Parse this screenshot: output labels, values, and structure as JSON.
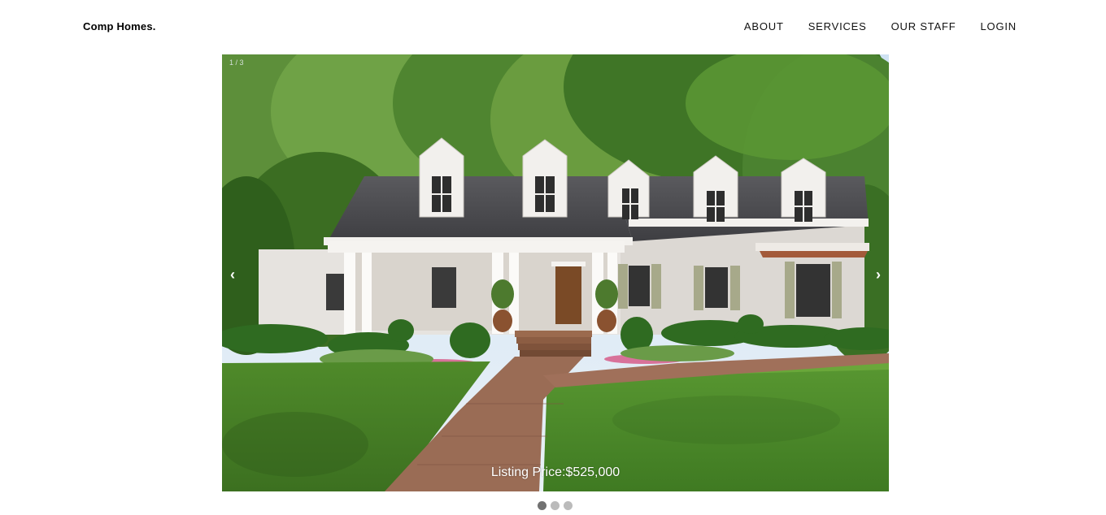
{
  "brand": "Comp Homes.",
  "nav": {
    "items": [
      {
        "label": "ABOUT"
      },
      {
        "label": "SERVICES"
      },
      {
        "label": "OUR STAFF"
      },
      {
        "label": "LOGIN"
      }
    ]
  },
  "slideshow": {
    "counter": "1 / 3",
    "prev_label": "‹",
    "next_label": "›",
    "caption": "Listing Price:$525,000",
    "active_slide": 1,
    "total_slides": 3
  },
  "colors": {
    "dot_active": "#717171",
    "dot_inactive": "#bbbbbb"
  }
}
